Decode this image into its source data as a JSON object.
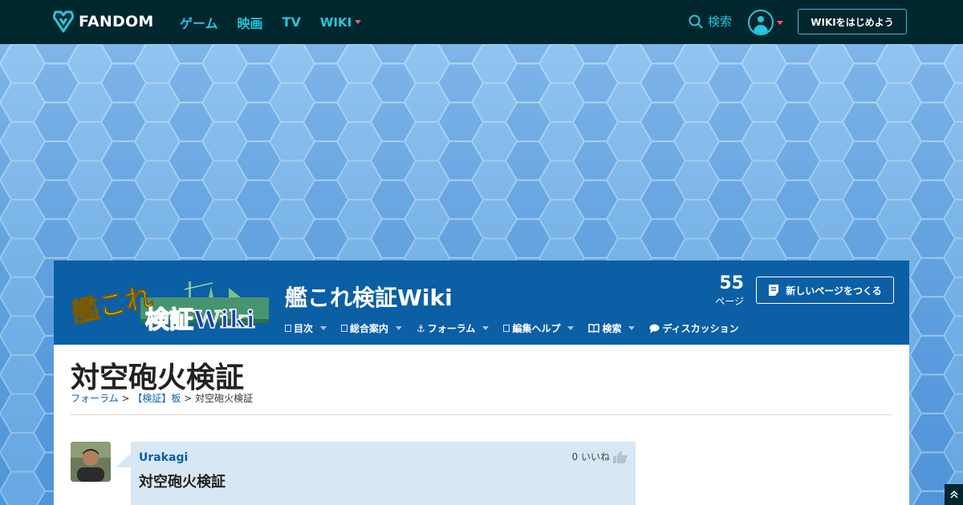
{
  "topbar": {
    "brand": "FANDOM",
    "nav": [
      {
        "label": "ゲーム"
      },
      {
        "label": "映画"
      },
      {
        "label": "TV"
      },
      {
        "label": "WIKI"
      }
    ],
    "search_label": "検索",
    "start_wiki_label": "WIKIをはじめよう"
  },
  "wiki": {
    "name": "艦これ検証Wiki",
    "page_count": "55",
    "page_count_label": "ページ",
    "new_page_label": "新しいページをつくる",
    "nav": [
      {
        "label": "目次"
      },
      {
        "label": "総合案内"
      },
      {
        "label": "フォーラム"
      },
      {
        "label": "編集ヘルプ"
      },
      {
        "label": "検索"
      },
      {
        "label": "ディスカッション"
      }
    ]
  },
  "page": {
    "title": "対空砲火検証",
    "breadcrumb": {
      "forum": "フォーラム",
      "sep1": ">",
      "board": "【検証】板",
      "sep2": ">",
      "current": "対空砲火検証"
    }
  },
  "post": {
    "author": "Urakagi",
    "likes": "0 いいね",
    "text": "対空砲火検証"
  },
  "colors": {
    "topbar_bg": "#00262e",
    "accent": "#26c6da",
    "wiki_header_bg": "#0b5fa5",
    "link": "#0b5fa5",
    "post_bg": "#d7e7f3"
  }
}
